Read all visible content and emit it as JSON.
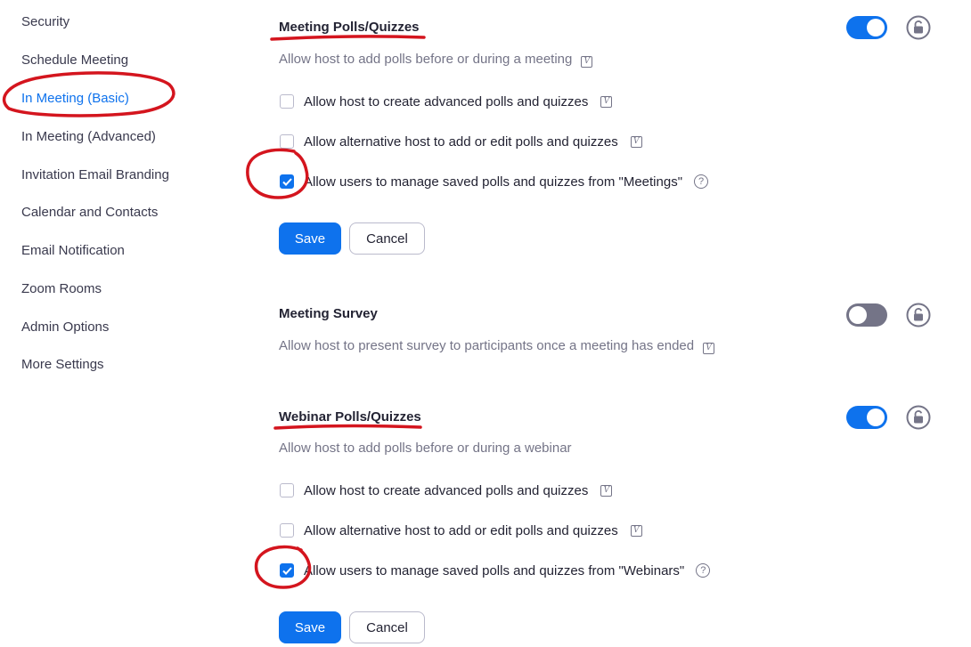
{
  "sidebar": {
    "items": [
      {
        "label": "Security"
      },
      {
        "label": "Schedule Meeting"
      },
      {
        "label": "In Meeting (Basic)"
      },
      {
        "label": "In Meeting (Advanced)"
      },
      {
        "label": "Invitation Email Branding"
      },
      {
        "label": "Calendar and Contacts"
      },
      {
        "label": "Email Notification"
      },
      {
        "label": "Zoom Rooms"
      },
      {
        "label": "Admin Options"
      },
      {
        "label": "More Settings"
      }
    ],
    "active_item": "In Meeting (Basic)"
  },
  "meeting_polls": {
    "title": "Meeting Polls/Quizzes",
    "description": "Allow host to add polls before or during a meeting",
    "enabled": true,
    "options": [
      {
        "label": "Allow host to create advanced polls and quizzes",
        "checked": false,
        "icon": "v-icon"
      },
      {
        "label": "Allow alternative host to add or edit polls and quizzes",
        "checked": false,
        "icon": "v-icon"
      },
      {
        "label": "Allow users to manage saved polls and quizzes from \"Meetings\"",
        "checked": true,
        "icon": "question-icon"
      }
    ],
    "save_label": "Save",
    "cancel_label": "Cancel"
  },
  "meeting_survey": {
    "title": "Meeting Survey",
    "description": "Allow host to present survey to participants once a meeting has ended",
    "enabled": false
  },
  "webinar_polls": {
    "title": "Webinar Polls/Quizzes",
    "description": "Allow host to add polls before or during a webinar",
    "enabled": true,
    "options": [
      {
        "label": "Allow host to create advanced polls and quizzes",
        "checked": false,
        "icon": "v-icon"
      },
      {
        "label": "Allow alternative host to add or edit polls and quizzes",
        "checked": false,
        "icon": "v-icon"
      },
      {
        "label": "Allow users to manage saved polls and quizzes from \"Webinars\"",
        "checked": true,
        "icon": "question-icon"
      }
    ],
    "save_label": "Save",
    "cancel_label": "Cancel"
  },
  "icons": {
    "v_glyph": "V",
    "question_glyph": "?"
  },
  "colors": {
    "accent": "#0e72ed",
    "annotation": "#d4151e",
    "toggle_off": "#747487"
  }
}
